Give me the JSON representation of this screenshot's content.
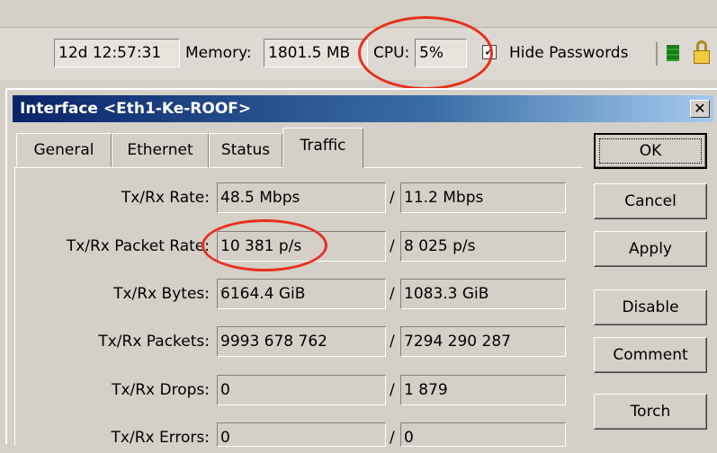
{
  "statusbar": {
    "uptime": "12d 12:57:31",
    "memory_label": "Memory:",
    "memory_value": "1801.5 MB",
    "cpu_label": "CPU:",
    "cpu_value": "5%",
    "hide_passwords_checked": "✓",
    "hide_passwords_label": "Hide Passwords"
  },
  "window": {
    "title": "Interface <Eth1-Ke-ROOF>",
    "close_glyph": "✕"
  },
  "tabs": [
    {
      "label": "General"
    },
    {
      "label": "Ethernet"
    },
    {
      "label": "Status"
    },
    {
      "label": "Traffic"
    }
  ],
  "traffic": {
    "separator": "/",
    "rows": [
      {
        "label": "Tx/Rx Rate:",
        "tx": "48.5 Mbps",
        "rx": "11.2 Mbps"
      },
      {
        "label": "Tx/Rx Packet Rate:",
        "tx": "10 381 p/s",
        "rx": "8 025 p/s"
      },
      {
        "label": "Tx/Rx Bytes:",
        "tx": "6164.4 GiB",
        "rx": "1083.3 GiB"
      },
      {
        "label": "Tx/Rx Packets:",
        "tx": "9993 678 762",
        "rx": "7294 290 287"
      },
      {
        "label": "Tx/Rx Drops:",
        "tx": "0",
        "rx": "1 879"
      },
      {
        "label": "Tx/Rx Errors:",
        "tx": "0",
        "rx": "0"
      }
    ]
  },
  "buttons": {
    "ok": "OK",
    "cancel": "Cancel",
    "apply": "Apply",
    "disable": "Disable",
    "comment": "Comment",
    "torch": "Torch"
  },
  "icons": {
    "status_indicator": "green-bars-icon",
    "lock": "lock-icon"
  },
  "colors": {
    "annotation": "#e8301c",
    "titlebar_start": "#0a246a",
    "titlebar_end": "#a6caf0"
  }
}
